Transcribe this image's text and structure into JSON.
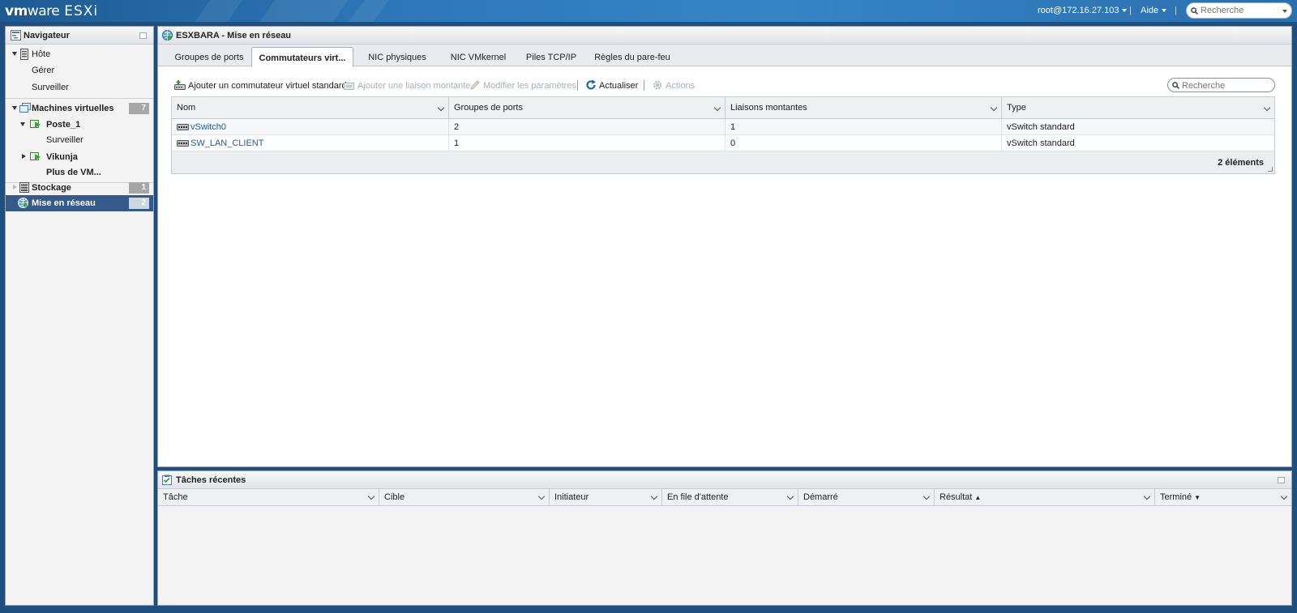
{
  "topbar": {
    "logo_vm": "vm",
    "logo_ware": "ware",
    "logo_product": "ESXi",
    "user": "root@172.16.27.103",
    "help": "Aide",
    "search_placeholder": "Recherche"
  },
  "navigator": {
    "title": "Navigateur",
    "host": "Hôte",
    "host_manage": "Gérer",
    "host_monitor": "Surveiller",
    "vms": "Machines virtuelles",
    "vms_count": "7",
    "vm1": "Poste_1",
    "vm1_monitor": "Surveiller",
    "vm2": "Vikunja",
    "more_vms": "Plus de VM...",
    "storage": "Stockage",
    "storage_count": "1",
    "networking": "Mise en réseau",
    "networking_count": "2"
  },
  "main": {
    "title": "ESXBARA - Mise en réseau",
    "tabs": [
      {
        "label": "Groupes de ports"
      },
      {
        "label": "Commutateurs virt..."
      },
      {
        "label": "NIC physiques"
      },
      {
        "label": "NIC VMkernel"
      },
      {
        "label": "Piles TCP/IP"
      },
      {
        "label": "Règles du pare-feu"
      }
    ],
    "toolbar": {
      "add_switch": "Ajouter un commutateur virtuel standard",
      "add_uplink": "Ajouter une liaison montante",
      "edit_settings": "Modifier les paramètres",
      "refresh": "Actualiser",
      "actions": "Actions",
      "search_placeholder": "Recherche"
    },
    "grid": {
      "columns": [
        "Nom",
        "Groupes de ports",
        "Liaisons montantes",
        "Type"
      ],
      "rows": [
        {
          "name": "vSwitch0",
          "port_groups": "2",
          "uplinks": "1",
          "type": "vSwitch standard"
        },
        {
          "name": "SW_LAN_CLIENT",
          "port_groups": "1",
          "uplinks": "0",
          "type": "vSwitch standard"
        }
      ],
      "footer_count": "2 éléments"
    }
  },
  "tasks": {
    "title": "Tâches récentes",
    "columns": [
      "Tâche",
      "Cible",
      "Initiateur",
      "En file d'attente",
      "Démarré",
      "Résultat",
      "Terminé"
    ]
  }
}
